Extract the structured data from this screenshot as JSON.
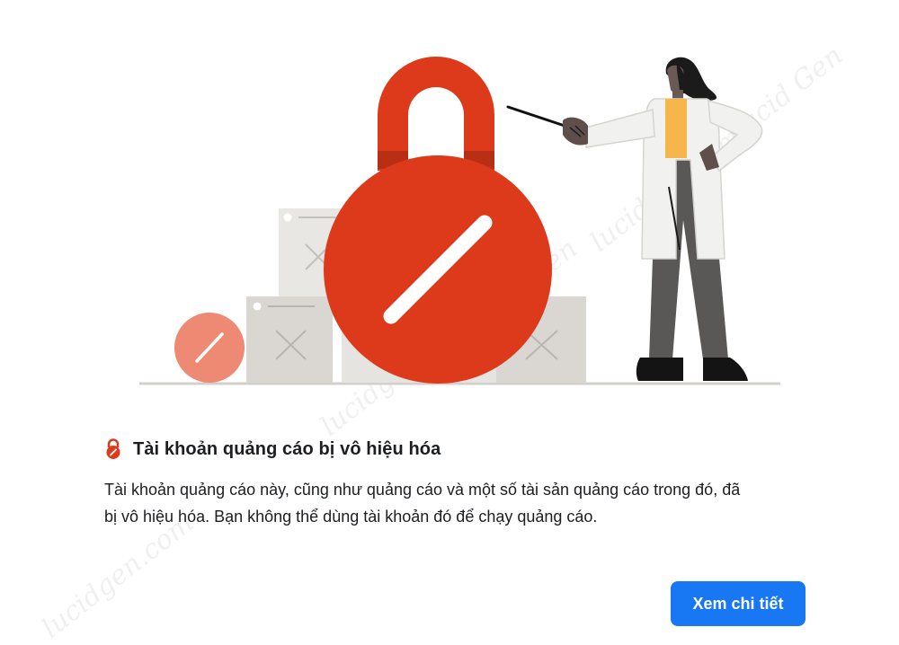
{
  "title": "Tài khoản quảng cáo bị vô hiệu hóa",
  "description_line1": "Tài khoản quảng cáo này, cũng như quảng cáo và một số tài sản quảng cáo trong đó, đã",
  "description_line2": "bị vô hiệu hóa. Bạn không thể dùng tài khoản đó để chạy quảng cáo.",
  "button_label": "Xem chi tiết",
  "watermarks": [
    "lucidgen.com",
    "Lucid Gen",
    "lucidgen.com",
    "Lucid Gen"
  ],
  "colors": {
    "accent": "#1877f2",
    "lock_red": "#dc3a1a",
    "lock_shade": "#b82f14",
    "small_disc": "#ee8a73",
    "box_gray": "#d9d6d1",
    "box_light": "#e9e7e4"
  },
  "icons": {
    "title_icon": "lock-icon",
    "hero": "padlock-illustration"
  }
}
